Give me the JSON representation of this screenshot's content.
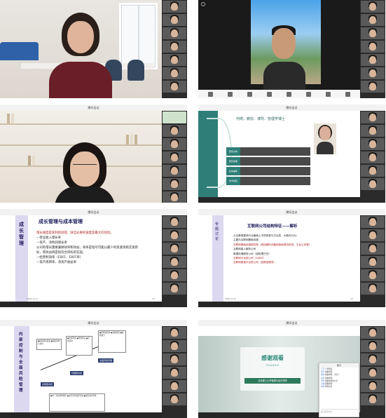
{
  "tiles": {
    "t1": {
      "name_tag": "",
      "labels": [
        "",
        "",
        "",
        "",
        "",
        ""
      ]
    },
    "t2": {
      "labels": [
        "",
        "",
        "",
        "",
        "",
        ""
      ]
    },
    "t3": {
      "title": "腾讯会议"
    },
    "t4": {
      "window_title": "腾讯会议",
      "slide_title": "何琦，教授、博导、管理学博士",
      "rows": [
        {
          "tag": "研究方向",
          "body": ""
        },
        {
          "tag": "研究成果",
          "body": ""
        },
        {
          "tag": "社会兼职",
          "body": ""
        },
        {
          "tag": "学术成就",
          "body": ""
        }
      ]
    },
    "t5": {
      "window_title": "腾讯会议",
      "side_title": "成长管理",
      "slide_title": "成长管理与成本管理",
      "bullets": [
        {
          "text": "增长速度是获利的前提，缺乏必要的速度是最大的风险。",
          "red": "增长速度"
        },
        {
          "text": "—营业收入增长率",
          "red": ""
        },
        {
          "text": "—资产、净利润增长率",
          "red": ""
        },
        {
          "text": "公司的增长需要兼顾效率和效益，效率是指尽可能以最少的资源消耗实现目标，而效益则是指符合目标的实现。",
          "red": ""
        },
        {
          "text": "—经营利润率（EBIT、EBIT率）",
          "red": ""
        },
        {
          "text": "—资产周转率、净资产收益率",
          "red": ""
        }
      ],
      "footer_left": "2021-11-9",
      "footer_right": "11"
    },
    "t6": {
      "window_title": "腾讯会议",
      "side_title": "专题讨论",
      "slide_title": "互联网公司结构特征——解析",
      "lines": [
        {
          "text": "从互联网整体行业格局上不同的参与方出发，大致可分为：",
          "red": false
        },
        {
          "text": "主要为互联网基础设施",
          "red": false
        },
        {
          "text": "互联网基础设施提供商（例如硬件设备制造商提供系统、平台公司等）",
          "red": true
        },
        {
          "text": "互联网接入服务公司",
          "red": false
        },
        {
          "text": "数据存储服务公司（如阿里巴巴）",
          "red": false
        },
        {
          "text": "互联网平台型公司（NBAT）",
          "red": true
        },
        {
          "text": "互联网垂直平台型公司（如微信服务）",
          "red": true
        }
      ],
      "footer_left": "2021-11-9",
      "footer_right": "13"
    },
    "t7": {
      "window_title": "腾讯会议",
      "side_title": "内部控制与全面风险管理",
      "boxes": [
        "●组织目标要素\n●组织结构与文化",
        "●内部环境\n●风险评估\n●控制活动",
        "●风险监控制\n●资源配置\n●权限划分",
        "●全面风险管理",
        "管理型内控",
        "合规型内控",
        "●单一活动风险防控\n●业务条件发挥有效\n●规范进行审核",
        "●业务流程管理\n●协调内外部关系"
      ],
      "tags": [
        "合规型内控",
        "管理型内控",
        "全面风险管理"
      ]
    },
    "t8": {
      "window_title": "腾讯会议",
      "thanks_cn": "感谢观看",
      "thanks_en": "THANKS",
      "school": "北京理工大学管理与经济学院",
      "chat_title": "聊天",
      "chat_lines": [
        {
          "n": "王汇宁",
          "m": "老师好"
        },
        {
          "n": "张宁",
          "m": "谢谢老师"
        },
        {
          "n": "赵明",
          "m": "感谢老师，辛苦了"
        },
        {
          "n": "刘宝",
          "m": "谢谢老师"
        },
        {
          "n": "李华",
          "m": "谢谢老师的分享"
        },
        {
          "n": "王敏",
          "m": "谢谢老师"
        },
        {
          "n": "孙萍",
          "m": "老师辛苦"
        }
      ],
      "chat_placeholder": "输入聊天内容"
    }
  },
  "sidebar_label": ""
}
